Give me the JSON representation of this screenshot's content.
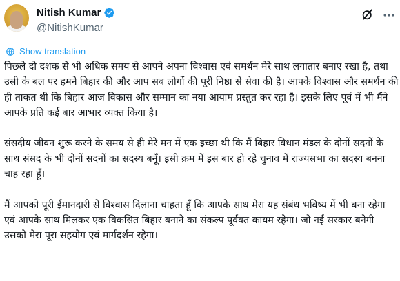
{
  "author": {
    "display_name": "Nitish Kumar",
    "handle": "@NitishKumar",
    "verified": true
  },
  "actions": {
    "grok_icon": "grok-icon",
    "more_icon": "more-icon"
  },
  "translate": {
    "label": "Show translation",
    "icon": "translate-icon"
  },
  "post": {
    "paragraphs": [
      "पिछले दो दशक से भी अधिक समय से आपने अपना विश्वास एवं समर्थन मेरे साथ लगातार बनाए रखा है, तथा उसी के बल पर हमने बिहार की और आप सब लोगों की पूरी निष्ठा से सेवा की है। आपके विश्वास और समर्थन की ही ताकत थी कि बिहार आज विकास और सम्मान का नया आयाम प्रस्तुत कर रहा है। इसके लिए पूर्व में भी मैंने आपके प्रति कई बार आभार व्यक्त किया है।",
      "संसदीय जीवन शुरू करने के समय से ही मेरे मन में एक इच्छा थी कि मैं बिहार विधान मंडल के दोनों सदनों के साथ संसद के भी दोनों सदनों का सदस्य बनूँ। इसी क्रम में इस बार हो रहे चुनाव में राज्यसभा का सदस्य बनना चाह रहा हूँ।",
      "मैं आपको पूरी ईमानदारी से विश्वास दिलाना चाहता हूँ कि आपके साथ मेरा यह संबंध भविष्य में भी बना रहेगा एवं आपके साथ मिलकर एक विकसित बिहार बनाने का संकल्प पूर्ववत कायम रहेगा। जो नई सरकार बनेगी उसको मेरा पूरा सहयोग एवं मार्गदर्शन रहेगा।"
    ]
  },
  "colors": {
    "text": "#0f1419",
    "secondary": "#536471",
    "accent": "#1d9bf0"
  }
}
